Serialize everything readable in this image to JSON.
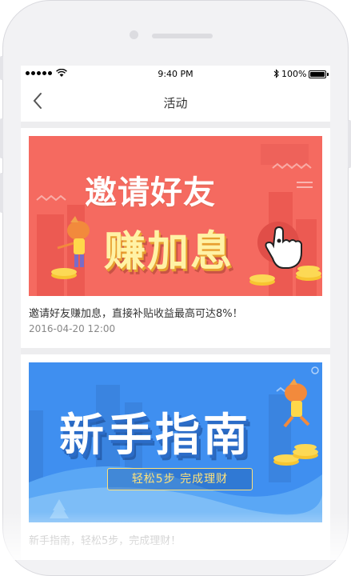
{
  "status_bar": {
    "time": "9:40 PM",
    "battery": "100%",
    "bluetooth_icon": "bluetooth-icon",
    "wifi_icon": "wifi-icon",
    "signal_icon": "signal-dots-icon"
  },
  "nav": {
    "title": "活动",
    "back_icon": "chevron-left-icon"
  },
  "cards": [
    {
      "banner_line1": "邀请好友",
      "banner_line2": "赚加息",
      "title": "邀请好友赚加息，直接补贴收益最高可达8%！",
      "date": "2016-04-20 12:00"
    },
    {
      "banner_line1": "新手指南",
      "banner_sub": "轻松5步 完成理财",
      "title": "新手指南，轻松5步，完成理财！"
    }
  ],
  "colors": {
    "banner1_bg": "#f56a60",
    "banner2_bg": "#3f8ff0",
    "gold": "#f7c531"
  }
}
